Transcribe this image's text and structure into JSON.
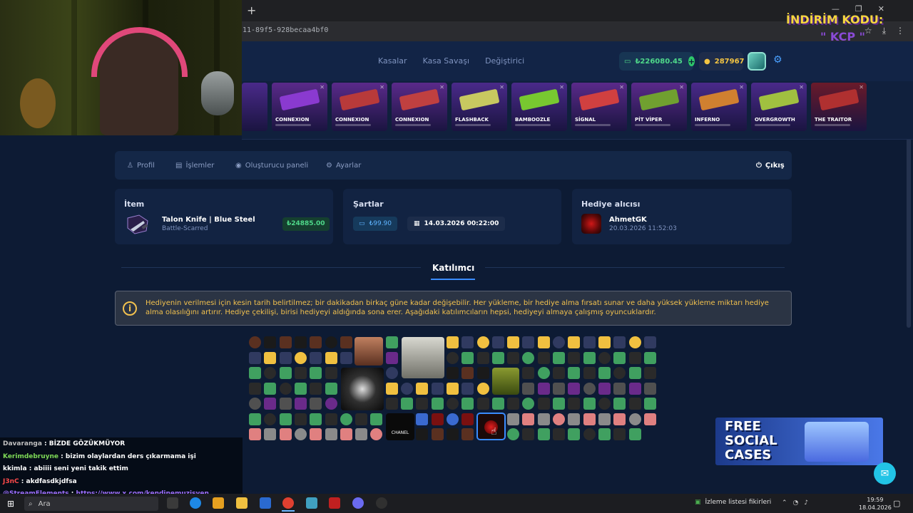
{
  "browser": {
    "new_tab": "+",
    "url": "11-89f5-928becaa4bf0",
    "window_controls": [
      "—",
      "❐",
      "✕"
    ]
  },
  "header": {
    "nav": [
      "Kasalar",
      "Kasa Savaşı",
      "Değiştirici"
    ],
    "balance": "₺226080.45",
    "coins": "287967"
  },
  "drops": [
    {
      "name": "CONNEXION",
      "bg": "#5a2a8a",
      "gun": "#8a3ad0"
    },
    {
      "name": "CONNEXION",
      "bg": "#5a2a8a",
      "gun": "#b83a3a"
    },
    {
      "name": "CONNEXION",
      "bg": "#5a2a8a",
      "gun": "#c04040"
    },
    {
      "name": "FLASHBACK",
      "bg": "#4a2a8a",
      "gun": "#c8c860"
    },
    {
      "name": "BAMBOOZLE",
      "bg": "#4a2a8a",
      "gun": "#78c830"
    },
    {
      "name": "SİGNAL",
      "bg": "#5a2a8a",
      "gun": "#d04040"
    },
    {
      "name": "PİT VİPER",
      "bg": "#5a2a8a",
      "gun": "#70a030"
    },
    {
      "name": "INFERNO",
      "bg": "#4a2a8a",
      "gun": "#d08030"
    },
    {
      "name": "OVERGROWTH",
      "bg": "#4a2a8a",
      "gun": "#a0c040"
    },
    {
      "name": "THE TRAITOR",
      "bg": "#6a1a2a",
      "gun": "#b03030"
    }
  ],
  "tabs": {
    "profile": "Profil",
    "transactions": "İşlemler",
    "creator": "Oluşturucu paneli",
    "settings": "Ayarlar",
    "logout": "Çıkış"
  },
  "item_card": {
    "title": "İtem",
    "name": "Talon Knife | Blue Steel",
    "condition": "Battle-Scarred",
    "price": "₺24885.00"
  },
  "requirements_card": {
    "title": "Şartlar",
    "deposit": "₺99.90",
    "deadline": "14.03.2026 00:22:00"
  },
  "gift_card": {
    "title": "Hediye alıcısı",
    "name": "AhmetGK",
    "date": "20.03.2026 11:52:03"
  },
  "participants": {
    "title": "Katılımcı",
    "notice": "Hediyenin verilmesi için kesin tarih belirtilmez; bir dakikadan birkaç güne kadar değişebilir. Her yükleme, bir hediye alma fırsatı sunar ve daha yüksek yükleme miktarı hediye alma olasılığını artırır. Hediye çekilişi, birisi hediyeyi aldığında sona erer. Aşağıdaki katılımcıların hepsi, hediyeyi almaya çalışmış oyuncuklardır.",
    "big_label": "CHANEL"
  },
  "stream": {
    "promo": "İNDİRİM KODU:",
    "code": "\" KCP \"",
    "chat": [
      {
        "user": "Davaranga",
        "text": "BİZDE GÖZÜKMÜYOR",
        "color": "#c0c0c0"
      },
      {
        "user": "Kerimdebruyne",
        "text": "bizim olaylardan ders çıkarmama işi",
        "color": "#7ed957"
      },
      {
        "user": "kkimla",
        "text": "abiiii seni yeni takik ettim",
        "color": "#ffffff"
      },
      {
        "user": "J3nC",
        "text": "akdfasdkjdfsa",
        "color": "#ff4a4a"
      },
      {
        "user": "@StreamElements",
        "text": "https://www.x.com/kendinemuzisyen",
        "color": "#a070ff"
      }
    ],
    "social": "FREE SOCIAL CASES"
  },
  "taskbar": {
    "search": "Ara",
    "news": "İzleme listesi fikirleri",
    "time": "19:59",
    "date": "18.04.2026"
  }
}
